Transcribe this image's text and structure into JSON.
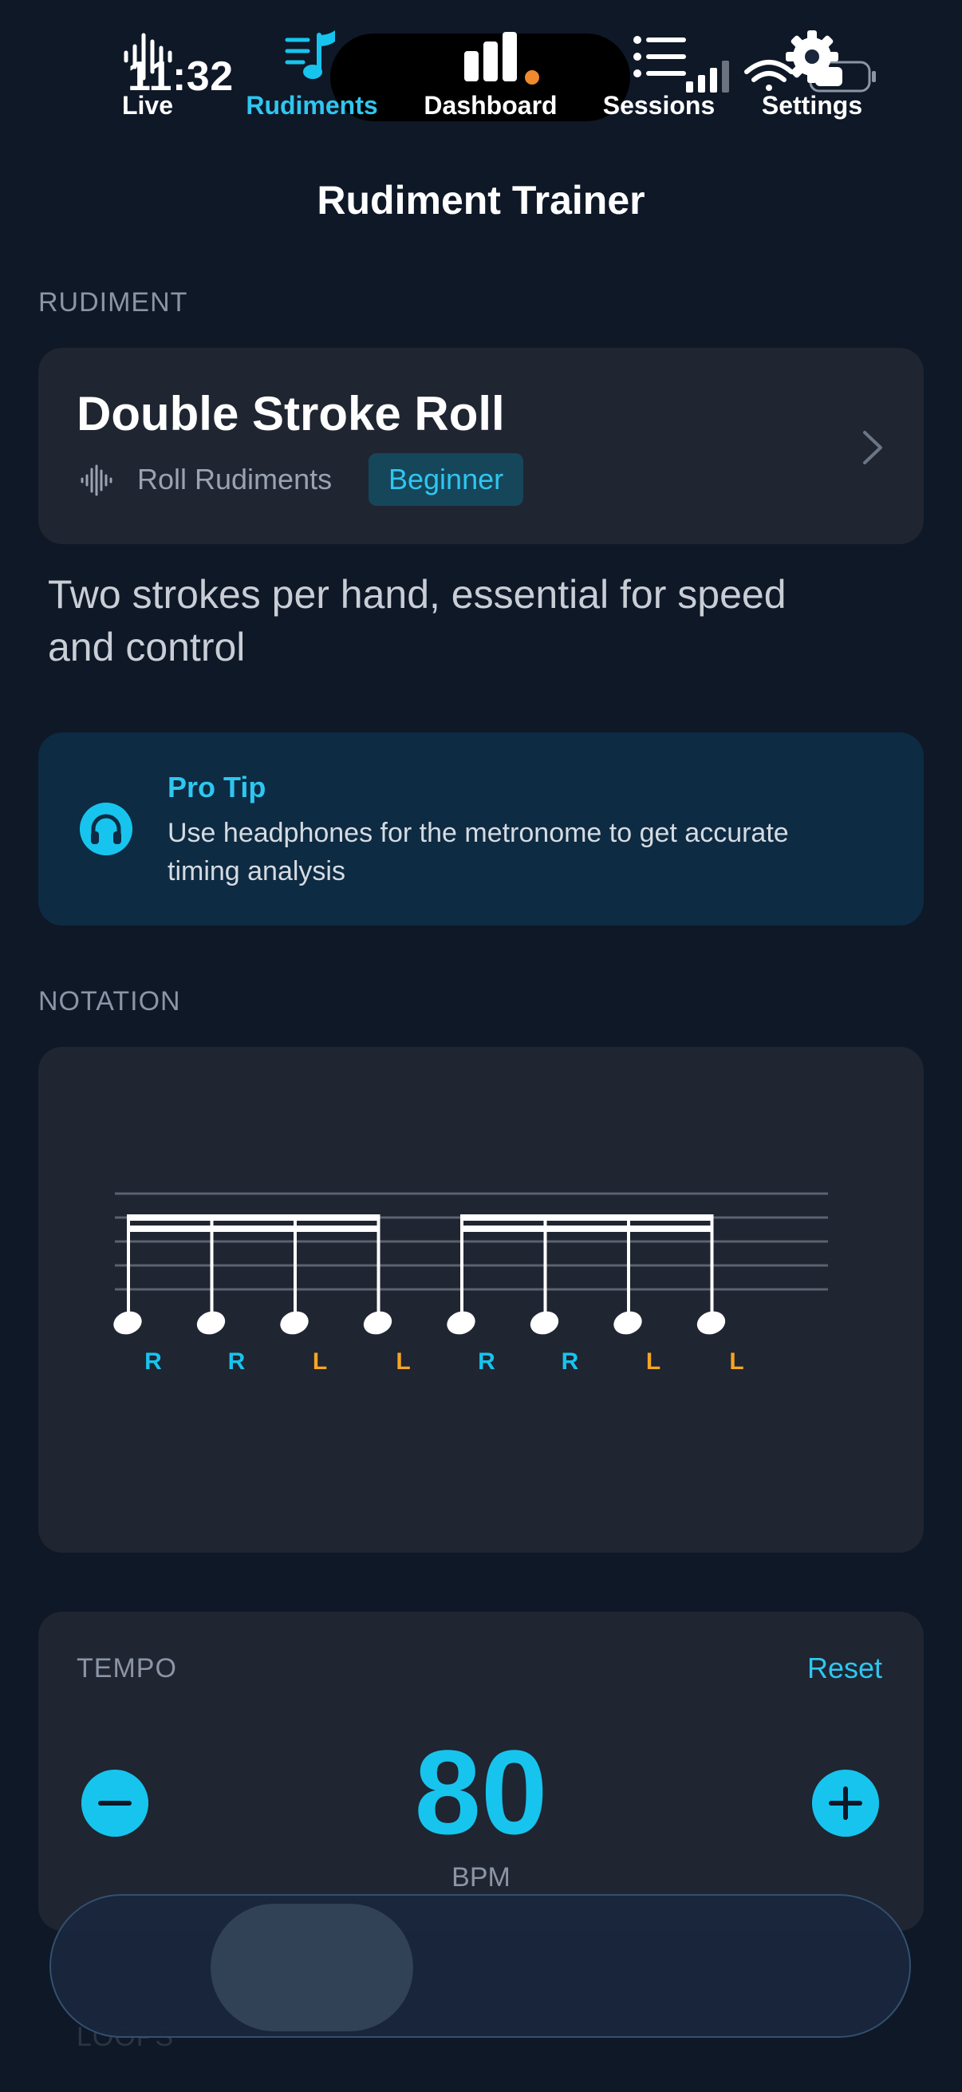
{
  "status_bar": {
    "time": "11:32"
  },
  "nav": {
    "title": "Rudiment Trainer"
  },
  "rudiment_section": {
    "label": "RUDIMENT",
    "name": "Double Stroke Roll",
    "category": "Roll Rudiments",
    "level": "Beginner",
    "description": "Two strokes per hand, essential for speed and control"
  },
  "pro_tip": {
    "title": "Pro Tip",
    "text": "Use headphones for the metronome to get accurate timing analysis"
  },
  "notation": {
    "label": "NOTATION",
    "sticking": [
      "R",
      "R",
      "L",
      "L",
      "R",
      "R",
      "L",
      "L"
    ],
    "colors": {
      "R": "#17c4ee",
      "L": "#f5a524"
    }
  },
  "tempo": {
    "label": "TEMPO",
    "reset_label": "Reset",
    "bpm": "80",
    "unit": "BPM"
  },
  "next_section_label": "LOOPS",
  "tabs": [
    {
      "label": "Live",
      "icon": "waveform-icon"
    },
    {
      "label": "Rudiments",
      "icon": "music-note-list-icon",
      "active": true
    },
    {
      "label": "Dashboard",
      "icon": "bar-chart-icon"
    },
    {
      "label": "Sessions",
      "icon": "list-icon"
    },
    {
      "label": "Settings",
      "icon": "gear-icon"
    }
  ],
  "colors": {
    "accent": "#17c4ee",
    "background": "#0f1827",
    "card": "#1f2531"
  }
}
